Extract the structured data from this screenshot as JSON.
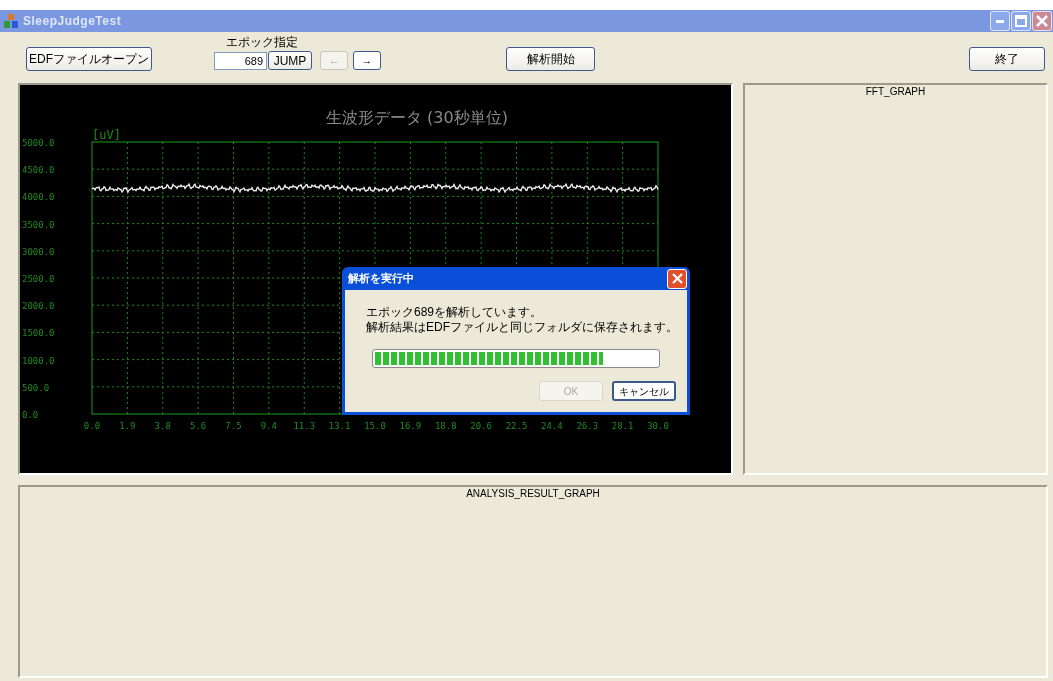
{
  "window": {
    "title": "SleepJudgeTest",
    "active": false
  },
  "toolbar": {
    "open_button": "EDFファイルオープン",
    "epoch_label": "エポック指定",
    "epoch_value": "689",
    "jump_button": "JUMP",
    "prev_button": {
      "label": "←",
      "disabled": true
    },
    "next_button": {
      "label": "→",
      "disabled": false
    },
    "start_button": "解析開始",
    "exit_button": "終了"
  },
  "raw_wave_panel": {
    "title": "生波形データ (30秒単位)",
    "unit": "[uV]",
    "y_labels": [
      "5000.0",
      "4500.0",
      "4000.0",
      "3500.0",
      "3000.0",
      "2500.0",
      "2000.0",
      "1500.0",
      "1000.0",
      "500.0",
      "0.0"
    ],
    "x_labels": [
      "0.0",
      "1.9",
      "3.8",
      "5.6",
      "7.5",
      "9.4",
      "11.3",
      "13.1",
      "15.0",
      "16.9",
      "18.8",
      "20.6",
      "22.5",
      "24.4",
      "26.3",
      "28.1",
      "30.0"
    ]
  },
  "fft_panel": {
    "title": "FFT_GRAPH"
  },
  "analysis_panel": {
    "title": "ANALYSIS_RESULT_GRAPH"
  },
  "dialog": {
    "title": "解析を実行中",
    "message_lines": [
      "エポック689を解析しています。",
      "解析結果はEDFファイルと同じフォルダに保存されます。"
    ],
    "level": 0.81,
    "buttons": [
      {
        "label": "OK",
        "disabled": true
      },
      {
        "label": "キャンセル",
        "disabled": false
      }
    ]
  }
}
